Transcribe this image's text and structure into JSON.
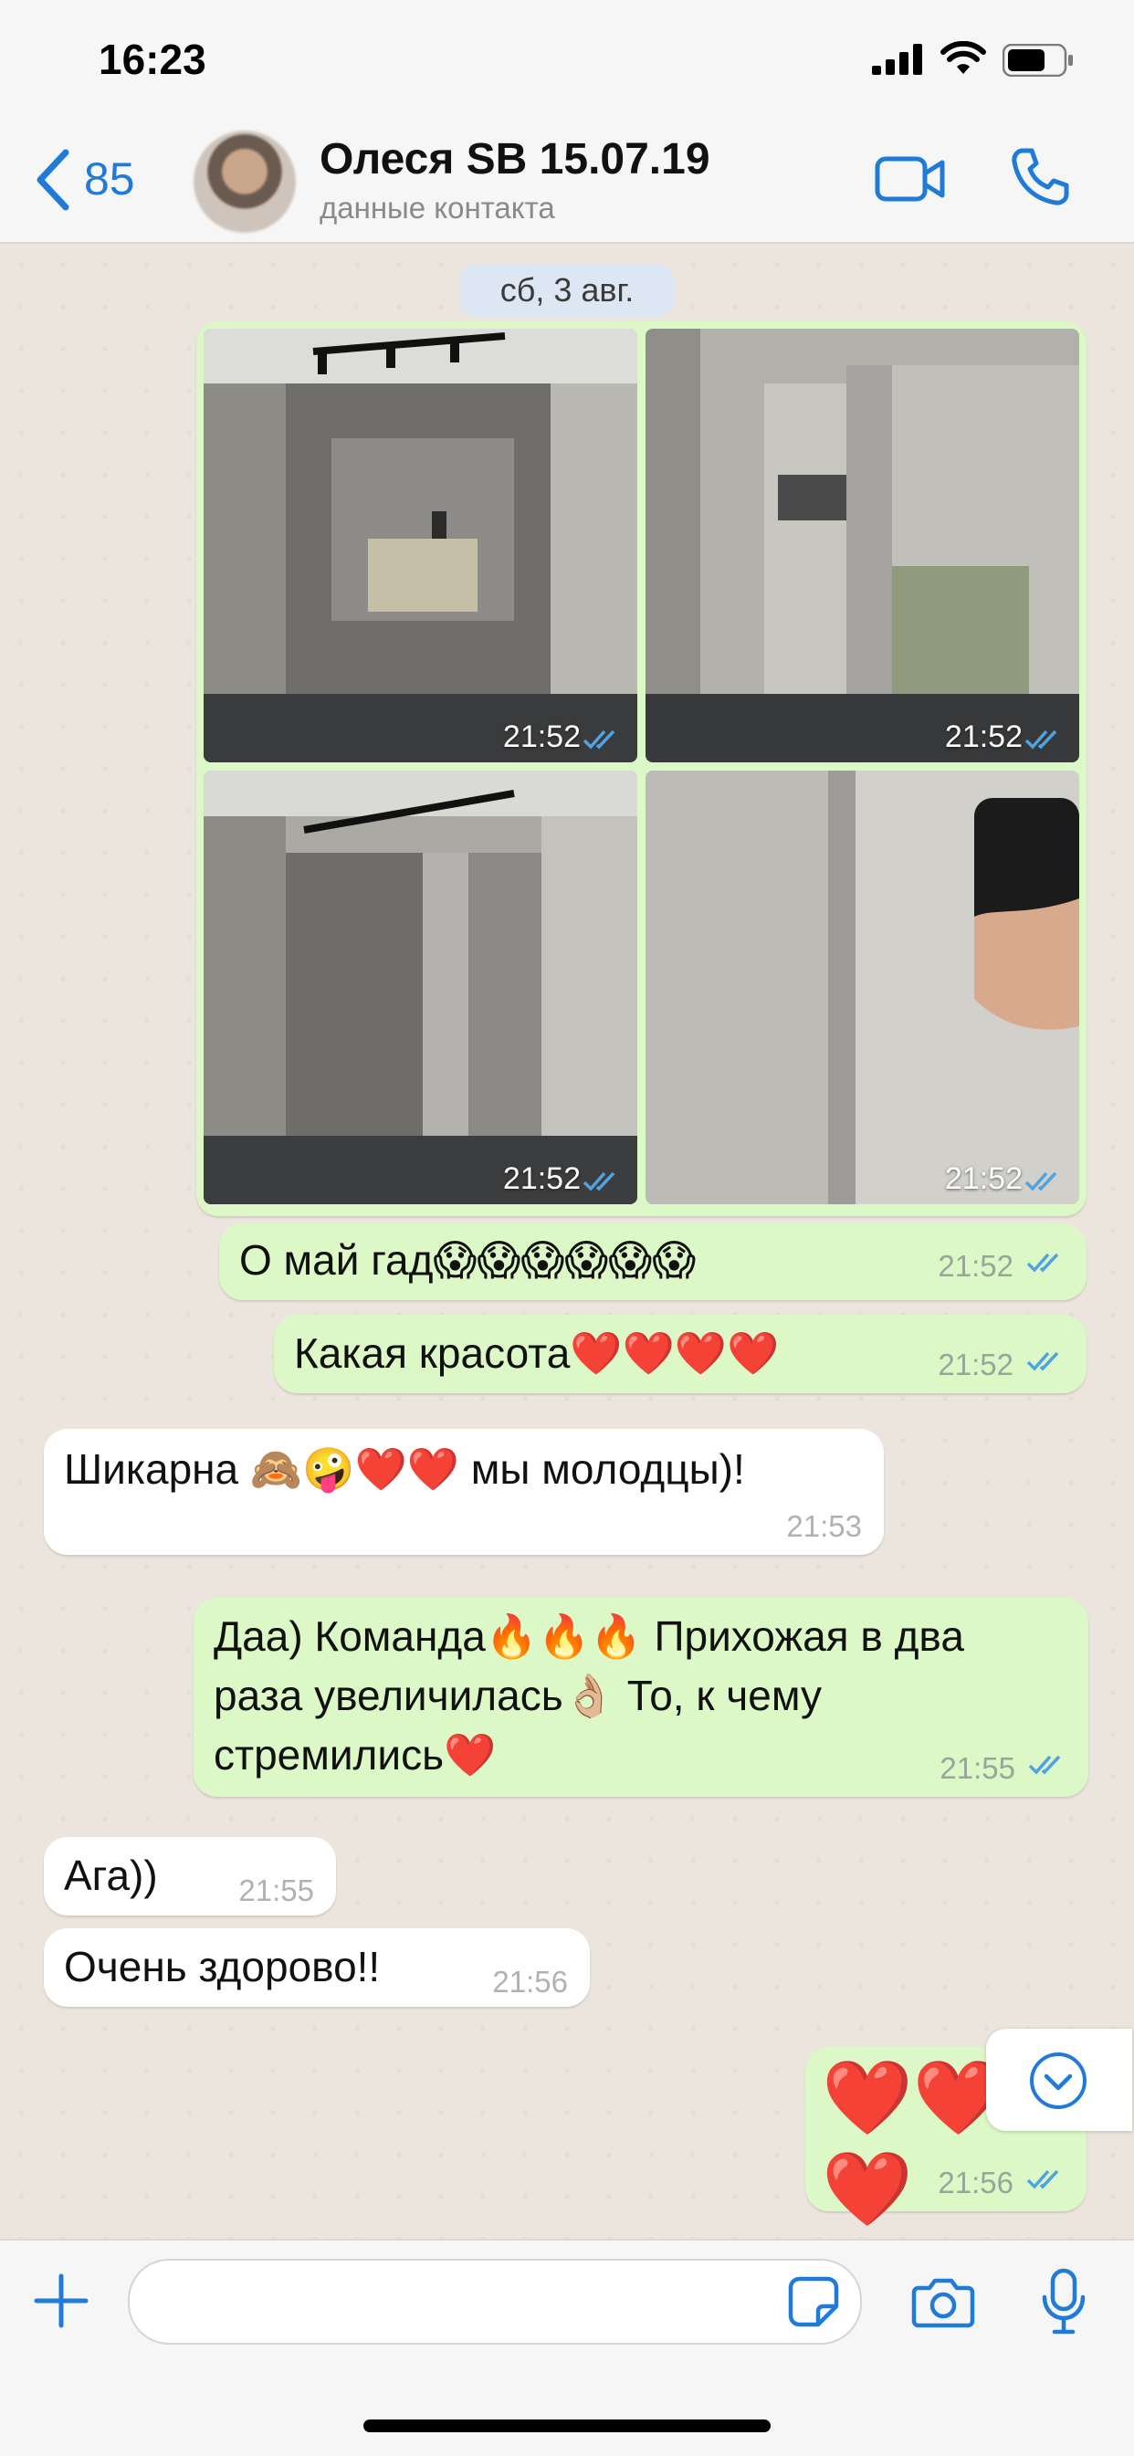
{
  "status_bar": {
    "time": "16:23"
  },
  "header": {
    "back_count": "85",
    "contact_name": "Олеся SB 15.07.19",
    "contact_subtitle": "данные контакта"
  },
  "chat": {
    "date": "сб, 3 авг.",
    "photos": [
      {
        "time": "21:52",
        "desc": "mirror-closet"
      },
      {
        "time": "21:52",
        "desc": "open-closet"
      },
      {
        "time": "21:52",
        "desc": "partially-open"
      },
      {
        "time": "21:52",
        "desc": "wall-closeup"
      }
    ],
    "messages": [
      {
        "dir": "out",
        "text": "О май гад😱😱😱😱😱😱",
        "time": "21:52",
        "read": true
      },
      {
        "dir": "out",
        "text": "Какая красота❤️❤️❤️❤️",
        "time": "21:52",
        "read": true
      },
      {
        "dir": "in",
        "text": "Шикарна 🙈🤪❤️❤️ мы молодцы)!",
        "time": "21:53"
      },
      {
        "dir": "out",
        "text_lines": [
          "Даа) Команда🔥🔥🔥 Прихожая в два",
          "раза увеличилась👌🏼 То, к чему",
          "стремились❤️"
        ],
        "time": "21:55",
        "read": true
      },
      {
        "dir": "in",
        "text": "Ага))",
        "time": "21:55"
      },
      {
        "dir": "in",
        "text": "Очень здорово!!",
        "time": "21:56"
      },
      {
        "dir": "out",
        "text": "❤️❤️❤️",
        "time": "21:56",
        "read": true
      }
    ]
  },
  "colors": {
    "accent": "#1f7ad8",
    "outgoing_bubble": "#dcf8c6",
    "incoming_bubble": "#ffffff",
    "read_checks": "#4fa3e0",
    "chat_bg": "#ece5dd"
  },
  "icons": [
    "chevron-left-icon",
    "video-call-icon",
    "phone-icon",
    "plus-icon",
    "sticker-icon",
    "camera-icon",
    "microphone-icon",
    "chevron-down-icon",
    "double-check-icon"
  ]
}
